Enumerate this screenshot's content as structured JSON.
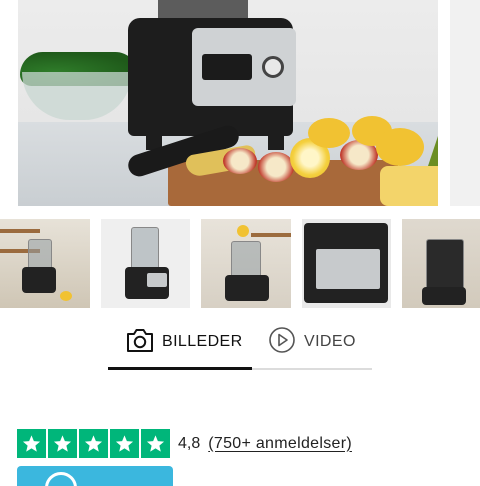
{
  "gallery": {
    "main_image": "blender-on-kitchen-counter-with-fruit",
    "thumbnails": [
      "blender-kitchen-shelf",
      "blender-studio",
      "blender-being-filled",
      "blender-control-panel-closeup",
      "blender-jar-closeup"
    ]
  },
  "tabs": {
    "photos_label": "BILLEDER",
    "video_label": "VIDEO",
    "active": "photos"
  },
  "rating": {
    "stars": 5,
    "value": "4,8",
    "count_link": "(750+ anmeldelser)",
    "star_color": "#00b67a"
  },
  "badge": {
    "color": "#3bb7de"
  }
}
